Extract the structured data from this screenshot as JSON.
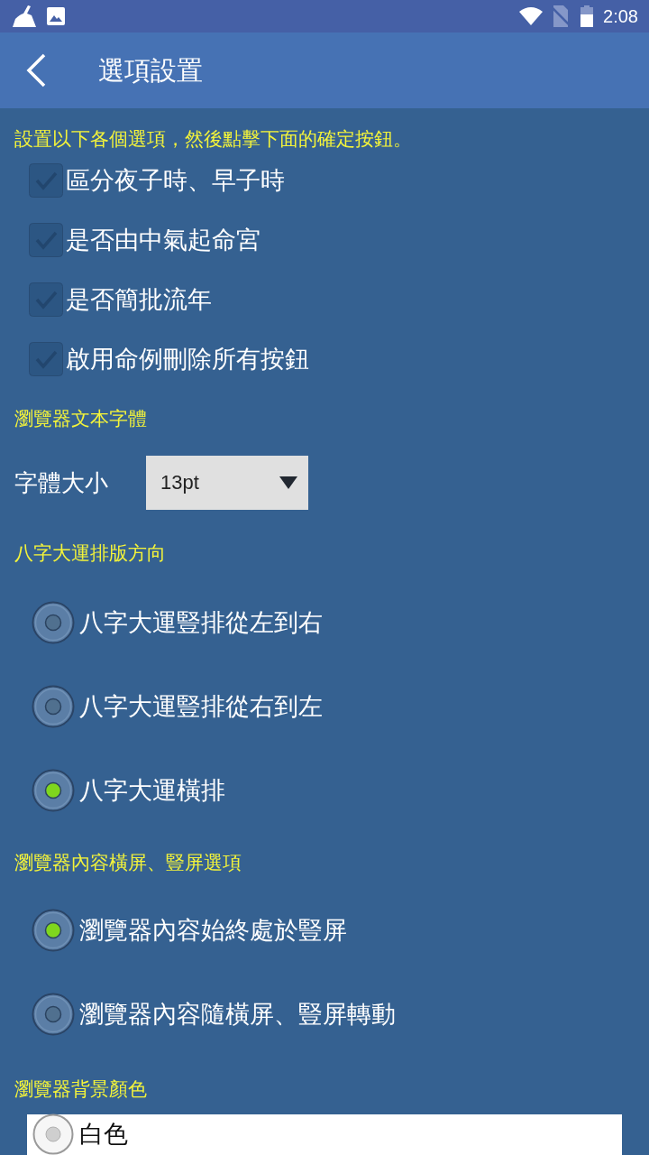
{
  "status_bar": {
    "time": "2:08"
  },
  "app_bar": {
    "title": "選項設置"
  },
  "instruction": "設置以下各個選項，然後點擊下面的確定按鈕。",
  "checkboxes": [
    {
      "label": "區分夜子時、早子時",
      "checked": false
    },
    {
      "label": "是否由中氣起命宮",
      "checked": false
    },
    {
      "label": "是否簡批流年",
      "checked": false
    },
    {
      "label": "啟用命例刪除所有按鈕",
      "checked": false
    }
  ],
  "font_section": {
    "heading": "瀏覽器文本字體",
    "label": "字體大小",
    "dropdown": {
      "value": "13pt"
    }
  },
  "layout_direction": {
    "heading": "八字大運排版方向",
    "options": [
      {
        "label": "八字大運豎排從左到右",
        "selected": false
      },
      {
        "label": "八字大運豎排從右到左",
        "selected": false
      },
      {
        "label": "八字大運橫排",
        "selected": true
      }
    ]
  },
  "screen_orientation": {
    "heading": "瀏覽器內容橫屏、豎屏選項",
    "options": [
      {
        "label": "瀏覽器內容始終處於豎屏",
        "selected": true
      },
      {
        "label": "瀏覽器內容隨橫屏、豎屏轉動",
        "selected": false
      }
    ]
  },
  "background_color": {
    "heading": "瀏覽器背景顏色",
    "options": [
      {
        "label": "白色",
        "selected": false
      }
    ]
  }
}
